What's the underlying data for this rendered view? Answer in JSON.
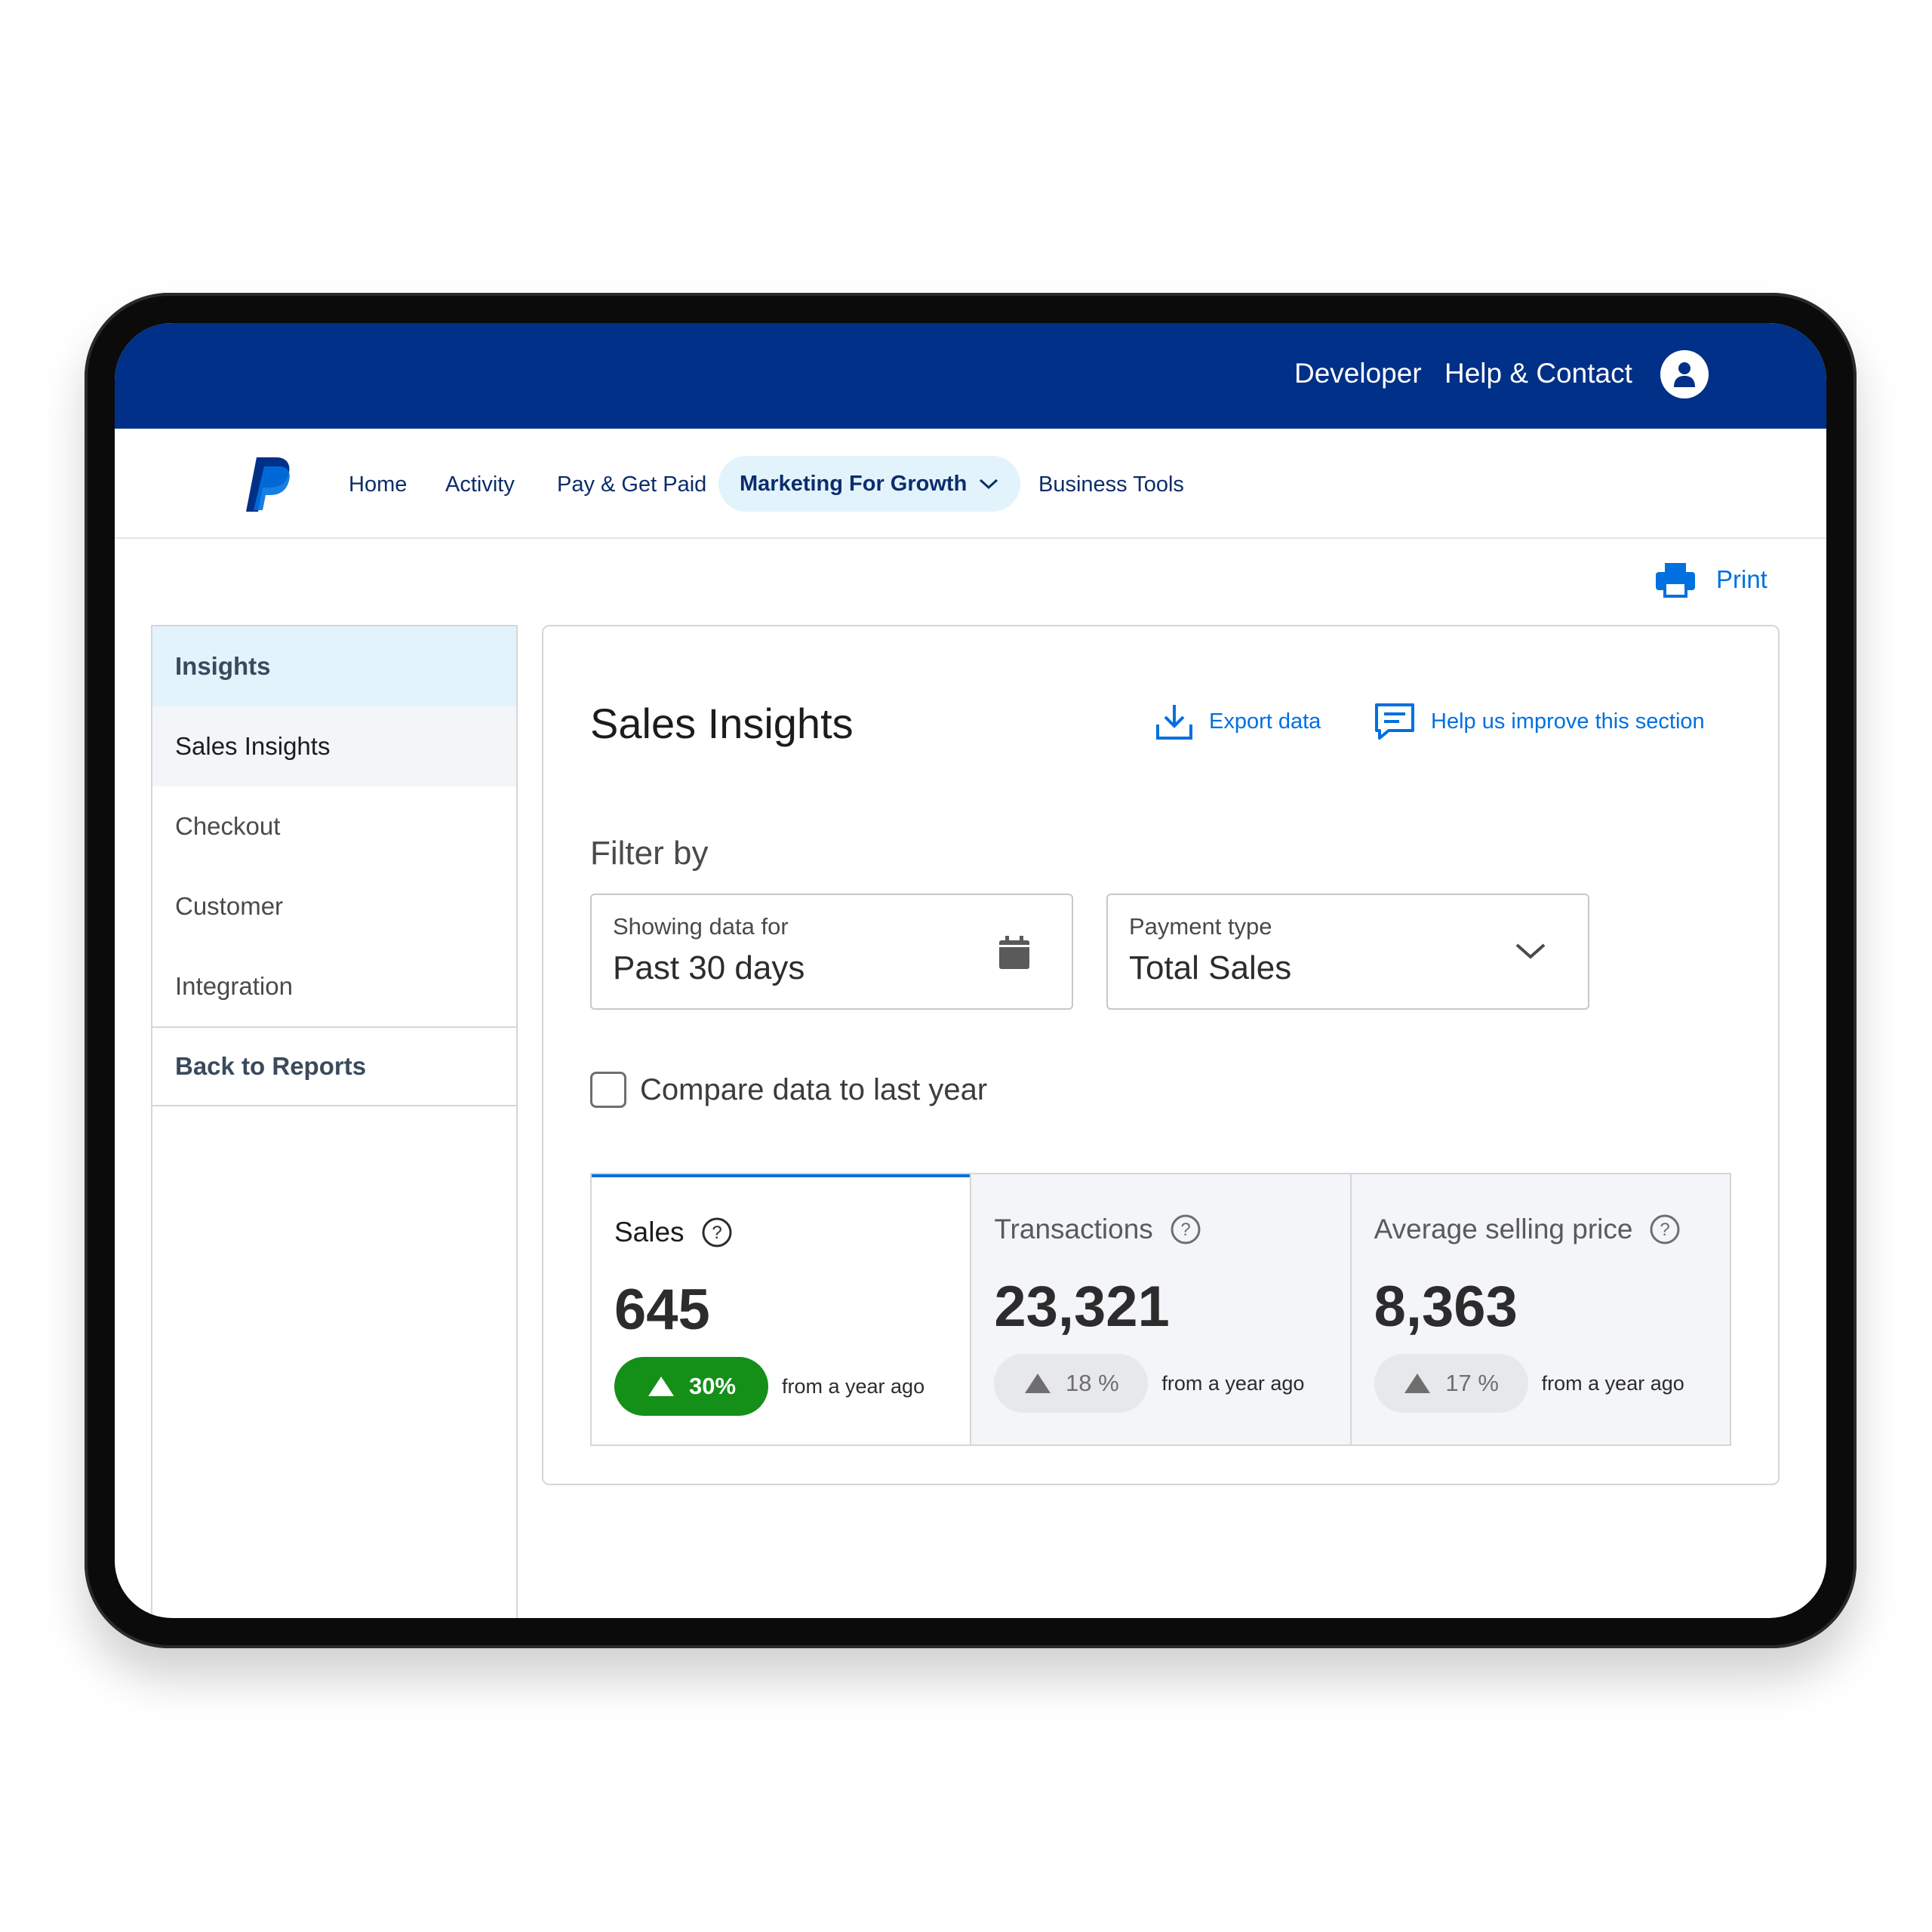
{
  "topbar": {
    "developer": "Developer",
    "help": "Help & Contact"
  },
  "nav": {
    "items": [
      "Home",
      "Activity",
      "Pay & Get Paid"
    ],
    "active": "Marketing For Growth",
    "business_tools": "Business Tools"
  },
  "print_label": "Print",
  "sidebar": {
    "header": "Insights",
    "items": [
      "Sales Insights",
      "Checkout",
      "Customer",
      "Integration"
    ],
    "back": "Back to Reports"
  },
  "card": {
    "title": "Sales Insights",
    "export": "Export data",
    "improve": "Help us improve this section",
    "filter_label": "Filter by",
    "date_filter": {
      "label": "Showing data for",
      "value": "Past 30 days"
    },
    "payment_filter": {
      "label": "Payment type",
      "value": "Total Sales"
    },
    "compare_label": "Compare data to last year"
  },
  "metrics": [
    {
      "label": "Sales",
      "value": "645",
      "change": "30%",
      "note": "from a year ago"
    },
    {
      "label": "Transactions",
      "value": "23,321",
      "change": "18 %",
      "note": "from a year ago"
    },
    {
      "label": "Average selling price",
      "value": "8,363",
      "change": "17 %",
      "note": "from a year ago"
    }
  ],
  "colors": {
    "brand_navy": "#003087",
    "link_blue": "#0070e0",
    "positive_green": "#148f18"
  }
}
